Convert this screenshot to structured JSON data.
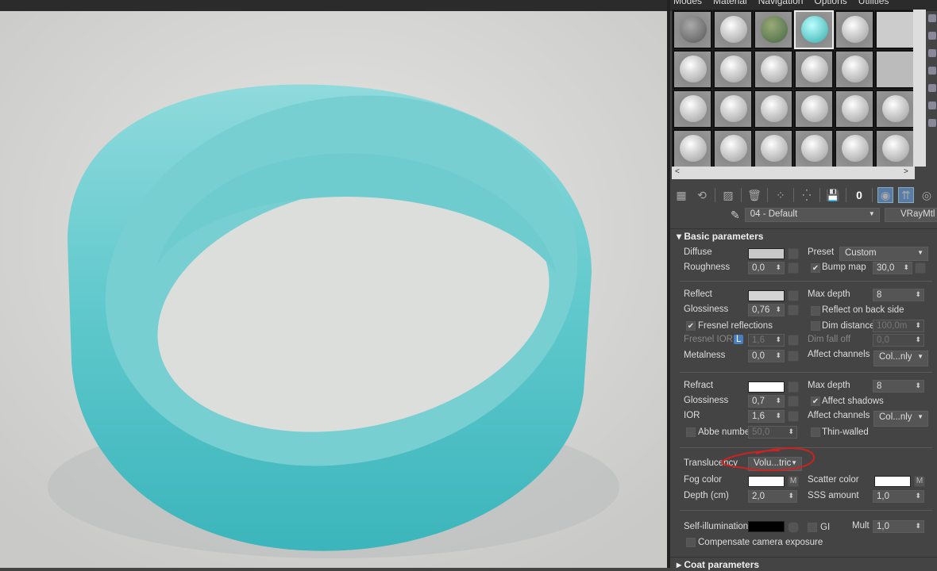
{
  "menu": [
    "Modes",
    "Material",
    "Navigation",
    "Options",
    "Utilities"
  ],
  "toolbar_icons": [
    "get-material-icon",
    "put-to-scene-icon",
    "assign-material-icon",
    "delete-icon",
    "make-unique-icon",
    "put-to-library-icon",
    "save-icon",
    "material-id-icon",
    "show-in-viewport-icon",
    "show-end-result-icon",
    "go-to-parent-icon",
    "go-forward-icon"
  ],
  "material": {
    "name": "04 - Default",
    "type": "VRayMtl"
  },
  "basic": {
    "title": "Basic parameters",
    "diffuse": "Diffuse",
    "preset": "Preset",
    "preset_val": "Custom",
    "roughness": "Roughness",
    "roughness_val": "0,0",
    "bump": "Bump map",
    "bump_val": "30,0",
    "reflect": "Reflect",
    "maxdepth": "Max depth",
    "maxdepth_val": "8",
    "gloss": "Glossiness",
    "gloss_val": "0,76",
    "reflect_back": "Reflect on back side",
    "fresnel": "Fresnel reflections",
    "dim_dist": "Dim distance",
    "dim_dist_val": "100,0m",
    "fresnel_ior": "Fresnel IOR",
    "lock": "L",
    "fresnel_ior_val": "1,6",
    "dim_falloff": "Dim fall off",
    "dim_falloff_val": "0,0",
    "metal": "Metalness",
    "metal_val": "0,0",
    "affect": "Affect channels",
    "affect_val": "Col...nly",
    "refract": "Refract",
    "rmaxdepth_val": "8",
    "rgloss_val": "0,7",
    "affect_shadows": "Affect shadows",
    "ior": "IOR",
    "ior_val": "1,6",
    "raffect_val": "Col...nly",
    "abbe": "Abbe number",
    "abbe_val": "50,0",
    "thin": "Thin-walled",
    "transl": "Translucency",
    "transl_val": "Volu...tric",
    "fog": "Fog color",
    "m": "M",
    "scatter": "Scatter color",
    "depth": "Depth (cm)",
    "depth_val": "2,0",
    "sss": "SSS amount",
    "sss_val": "1,0",
    "selfillum": "Self-illumination",
    "gi": "GI",
    "mult": "Mult",
    "mult_val": "1,0",
    "comp": "Compensate camera exposure"
  },
  "coat": {
    "title": "Coat parameters"
  },
  "colors": {
    "ring": "#4fc4c8",
    "annotation": "#cc2222",
    "panel": "#444444"
  }
}
